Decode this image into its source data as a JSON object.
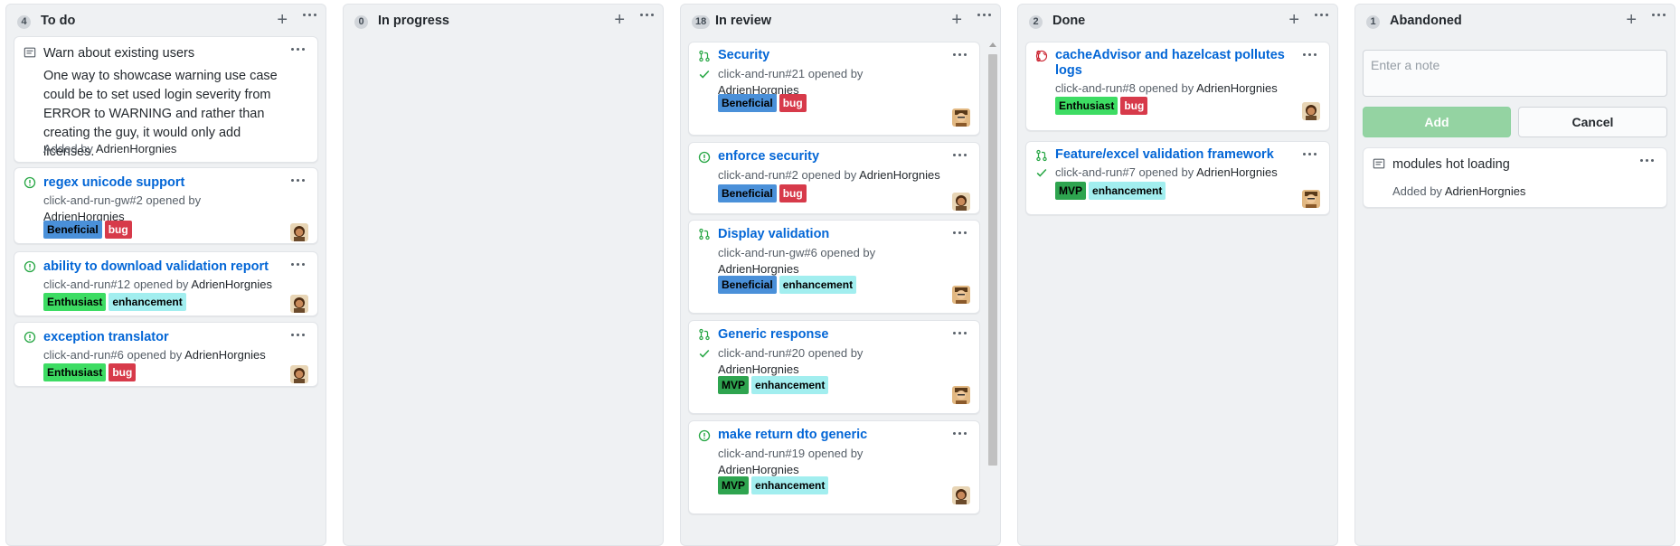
{
  "columns": [
    {
      "count": "4",
      "title": "To do",
      "cards": [
        {
          "type": "note",
          "title": "Warn about existing users",
          "body": "One way to showcase warning use case could be to set used login severity from ERROR to WARNING and rather than creating the guy, it would only add licenses.",
          "added_prefix": "Added by ",
          "added_user": "AdrienHorgnies"
        },
        {
          "type": "issue",
          "title": "regex unicode support",
          "meta_ref": "click-and-run-gw#2 opened by ",
          "meta_user": "AdrienHorgnies",
          "labels": [
            "Beneficial",
            "bug"
          ]
        },
        {
          "type": "issue",
          "title": "ability to download validation report",
          "meta_ref": "click-and-run#12 opened by ",
          "meta_user": "AdrienHorgnies",
          "labels": [
            "Enthusiast",
            "enhancement"
          ]
        },
        {
          "type": "issue",
          "title": "exception translator",
          "meta_ref": "click-and-run#6 opened by ",
          "meta_user": "AdrienHorgnies",
          "labels": [
            "Enthusiast",
            "bug"
          ]
        }
      ]
    },
    {
      "count": "0",
      "title": "In progress",
      "cards": []
    },
    {
      "count": "18",
      "title": "In review",
      "cards": [
        {
          "type": "pr",
          "title": "Security",
          "meta_ref": "click-and-run#21 opened by",
          "meta_user": "AdrienHorgnies",
          "labels": [
            "Beneficial",
            "bug"
          ]
        },
        {
          "type": "issue",
          "title": "enforce security",
          "meta_ref": "click-and-run#2 opened by ",
          "meta_user": "AdrienHorgnies",
          "labels": [
            "Beneficial",
            "bug"
          ]
        },
        {
          "type": "pr",
          "title": "Display validation",
          "meta_ref": "click-and-run-gw#6 opened by",
          "meta_user": "AdrienHorgnies",
          "labels": [
            "Beneficial",
            "enhancement"
          ]
        },
        {
          "type": "pr",
          "title": "Generic response",
          "meta_ref": "click-and-run#20 opened by",
          "meta_user": "AdrienHorgnies",
          "labels": [
            "MVP",
            "enhancement"
          ]
        },
        {
          "type": "issue",
          "title": "make return dto generic",
          "meta_ref": "click-and-run#19 opened by",
          "meta_user": "AdrienHorgnies",
          "labels": [
            "MVP",
            "enhancement"
          ]
        }
      ]
    },
    {
      "count": "2",
      "title": "Done",
      "cards": [
        {
          "type": "pr-closed",
          "title": "cacheAdvisor and hazelcast pollutes logs",
          "meta_ref": "click-and-run#8 opened by ",
          "meta_user": "AdrienHorgnies",
          "labels": [
            "Enthusiast",
            "bug"
          ]
        },
        {
          "type": "pr",
          "title": "Feature/excel validation framework",
          "meta_ref": "click-and-run#7 opened by ",
          "meta_user": "AdrienHorgnies",
          "labels": [
            "MVP",
            "enhancement"
          ]
        }
      ]
    },
    {
      "count": "1",
      "title": "Abandoned",
      "new_note": {
        "placeholder": "Enter a note",
        "add_label": "Add",
        "cancel_label": "Cancel"
      },
      "cards": [
        {
          "type": "note",
          "title": "modules hot loading",
          "added_prefix": "Added by ",
          "added_user": "AdrienHorgnies"
        }
      ]
    }
  ],
  "label_colors": {
    "Beneficial": "#4a90d9",
    "bug": "#d73a4a",
    "Enthusiast": "#3ddc63",
    "enhancement": "#a2eeef",
    "MVP": "#2ea44f"
  },
  "colors": {
    "open_issue": "#28a745",
    "closed_pr": "#cb2431",
    "check": "#28a745",
    "link": "#0366d6"
  },
  "icons": {
    "plus": "+",
    "more": "kebab-horizontal"
  }
}
